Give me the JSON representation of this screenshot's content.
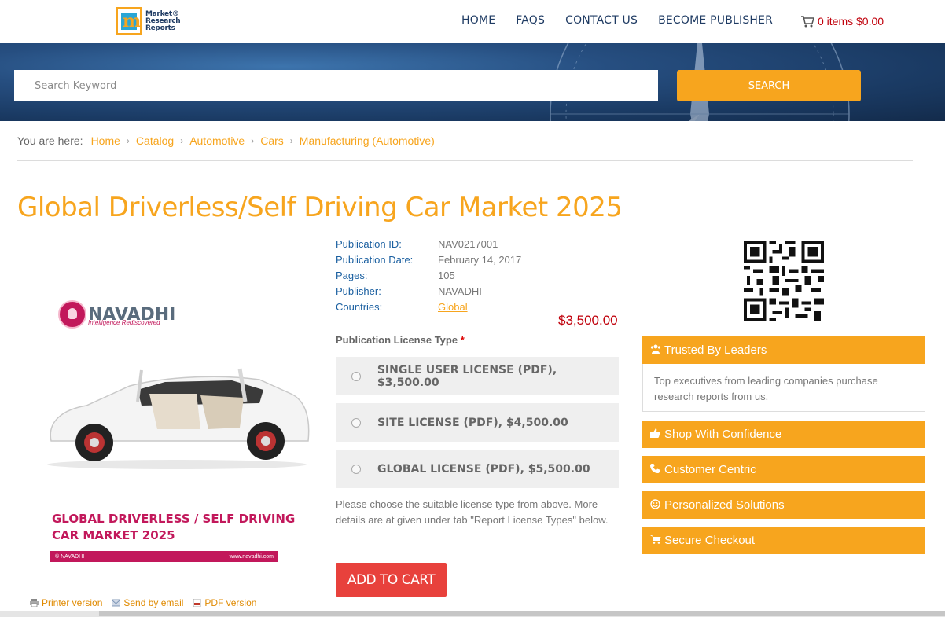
{
  "header": {
    "logo_lines": [
      "Market®",
      "Research",
      "Reports"
    ],
    "nav": [
      "HOME",
      "FAQS",
      "CONTACT US",
      "BECOME PUBLISHER"
    ],
    "cart_text": "0 items $0.00"
  },
  "search": {
    "placeholder": "Search Keyword",
    "button_label": "SEARCH"
  },
  "breadcrumb": {
    "label": "You are here:",
    "items": [
      "Home",
      "Catalog",
      "Automotive",
      "Cars",
      "Manufacturing (Automotive)"
    ]
  },
  "page_title": "Global Driverless/Self Driving Car Market 2025",
  "cover": {
    "brand": "NAVADHI",
    "tagline": "Intelligence Rediscovered",
    "title_line1": "GLOBAL DRIVERLESS / SELF DRIVING",
    "title_line2": "CAR MARKET 2025",
    "footer_left": "© NAVADHI",
    "footer_right": "www.navadhi.com"
  },
  "publication": {
    "id_label": "Publication ID:",
    "id": "NAV0217001",
    "date_label": "Publication Date:",
    "date": "February 14, 2017",
    "pages_label": "Pages:",
    "pages": "105",
    "publisher_label": "Publisher:",
    "publisher": "NAVADHI",
    "countries_label": "Countries:",
    "countries": "Global"
  },
  "price": "$3,500.00",
  "license": {
    "label": "Publication License Type",
    "required_mark": "*",
    "options": [
      "SINGLE USER LICENSE (PDF), $3,500.00",
      "SITE LICENSE (PDF), $4,500.00",
      "GLOBAL LICENSE (PDF), $5,500.00"
    ],
    "note": "Please choose the suitable license type from above. More details are at given under tab \"Report License Types\" below."
  },
  "add_to_cart_label": "ADD TO CART",
  "doc_links": [
    "Printer version",
    "Send by email",
    "PDF version"
  ],
  "sidebar": {
    "trusted_title": "Trusted By Leaders",
    "trusted_body": "Top executives from leading companies purchase research reports from us.",
    "items": [
      "Shop With Confidence",
      "Customer Centric",
      "Personalized Solutions",
      "Secure Checkout"
    ]
  },
  "colors": {
    "accent": "#f7a51e",
    "nav_text": "#1f3b63",
    "price_red": "#c0000b",
    "add_to_cart": "#e8413c",
    "cover_pink": "#c2185b",
    "label_blue": "#1a5fa0"
  }
}
